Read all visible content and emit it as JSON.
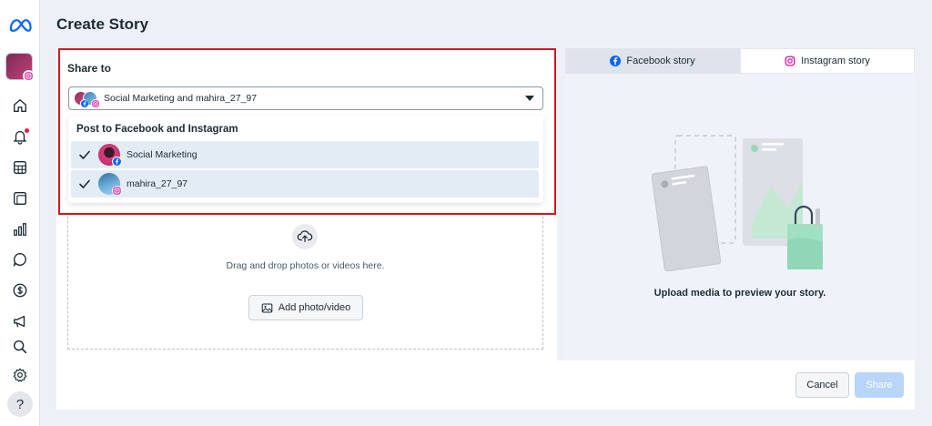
{
  "page": {
    "title": "Create Story"
  },
  "share": {
    "label": "Share to",
    "selected_value": "Social Marketing and mahira_27_97",
    "dropdown_header": "Post to Facebook and Instagram",
    "accounts": [
      {
        "name": "Social Marketing",
        "platform": "facebook",
        "checked": true
      },
      {
        "name": "mahira_27_97",
        "platform": "instagram",
        "checked": true
      }
    ]
  },
  "upload": {
    "drop_text": "Drag and drop photos or videos here.",
    "add_button": "Add photo/video"
  },
  "preview": {
    "tabs": [
      {
        "label": "Facebook story",
        "active": true,
        "icon": "facebook-icon"
      },
      {
        "label": "Instagram story",
        "active": false,
        "icon": "instagram-icon"
      }
    ],
    "empty_text": "Upload media to preview your story."
  },
  "footer": {
    "cancel_label": "Cancel",
    "share_label": "Share"
  },
  "colors": {
    "accent": "#0866ff",
    "highlight_border": "#d6141f",
    "share_disabled": "#b9d5f7",
    "selected_row": "#e3ecf4"
  },
  "sidebar": {
    "icons": [
      "meta-logo-icon",
      "home-icon",
      "bell-icon",
      "calendar-grid-icon",
      "pages-icon",
      "bar-chart-icon",
      "chat-bubble-icon",
      "dollar-icon",
      "megaphone-icon",
      "search-icon",
      "gear-icon",
      "help-icon"
    ]
  }
}
